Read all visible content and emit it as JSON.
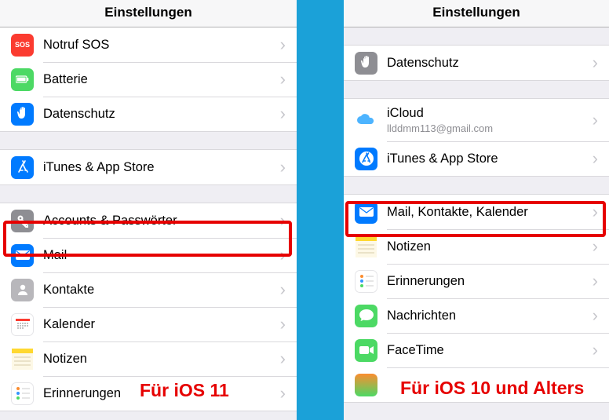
{
  "left": {
    "title": "Einstellungen",
    "caption": "Für iOS 11",
    "rows": [
      {
        "label": "Notruf SOS"
      },
      {
        "label": "Batterie"
      },
      {
        "label": "Datenschutz"
      },
      {
        "label": "iTunes & App Store"
      },
      {
        "label": "Accounts & Passwörter"
      },
      {
        "label": "Mail"
      },
      {
        "label": "Kontakte"
      },
      {
        "label": "Kalender"
      },
      {
        "label": "Notizen"
      },
      {
        "label": "Erinnerungen"
      }
    ]
  },
  "right": {
    "title": "Einstellungen",
    "caption": "Für iOS 10 und Alters",
    "rows": [
      {
        "label": "Datenschutz"
      },
      {
        "label": "iCloud",
        "sublabel": "llddmm113@gmail.com"
      },
      {
        "label": "iTunes & App Store"
      },
      {
        "label": "Mail, Kontakte, Kalender"
      },
      {
        "label": "Notizen"
      },
      {
        "label": "Erinnerungen"
      },
      {
        "label": "Nachrichten"
      },
      {
        "label": "FaceTime"
      }
    ]
  }
}
